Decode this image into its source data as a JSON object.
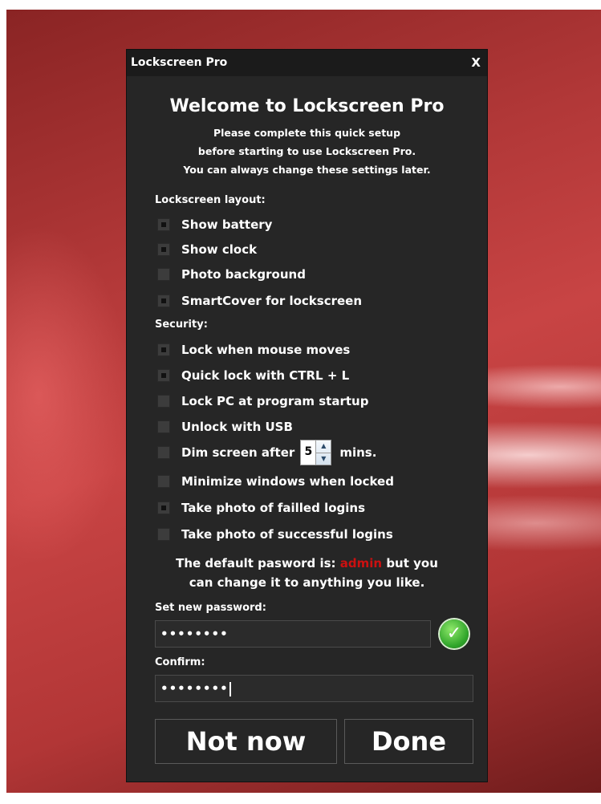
{
  "window": {
    "title": "Lockscreen Pro",
    "close_label": "X"
  },
  "heading": "Welcome to Lockscreen Pro",
  "intro": [
    "Please complete this quick setup",
    "before starting to use Lockscreen Pro.",
    "You can always change these settings later."
  ],
  "layout_section": {
    "label": "Lockscreen layout:",
    "options": [
      {
        "label": "Show battery",
        "checked": true
      },
      {
        "label": "Show clock",
        "checked": true
      },
      {
        "label": "Photo background",
        "checked": false
      },
      {
        "label": "SmartCover for lockscreen",
        "checked": true
      }
    ]
  },
  "security_section": {
    "label": "Security:",
    "options": [
      {
        "label": "Lock when mouse moves",
        "checked": true
      },
      {
        "label": "Quick lock with CTRL + L",
        "checked": true
      },
      {
        "label": "Lock PC at program startup",
        "checked": false
      },
      {
        "label": "Unlock with USB",
        "checked": false
      },
      {
        "label": "Dim screen after",
        "checked": false
      },
      {
        "label": "Minimize windows when locked",
        "checked": false
      },
      {
        "label": "Take photo of failled logins",
        "checked": true
      },
      {
        "label": "Take photo of successful logins",
        "checked": false
      }
    ],
    "dim_value": "5",
    "dim_unit": "mins."
  },
  "password_note": {
    "line1_before": "The default pasword is: ",
    "default_password": "admin",
    "line1_after": " but you",
    "line2": "can change it to anything you like."
  },
  "new_password": {
    "label": "Set new password:",
    "value": "••••••••"
  },
  "confirm_password": {
    "label": "Confirm:",
    "value": "••••••••"
  },
  "buttons": {
    "not_now": "Not now",
    "done": "Done"
  },
  "colors": {
    "window_bg": "#262626",
    "titlebar_bg": "#1b1b1b",
    "highlight": "#cc1010",
    "valid_icon": "#2fa52a"
  },
  "icons": {
    "valid": "checkmark-circle-icon",
    "spin_up": "arrow-up-icon",
    "spin_down": "arrow-down-icon"
  }
}
